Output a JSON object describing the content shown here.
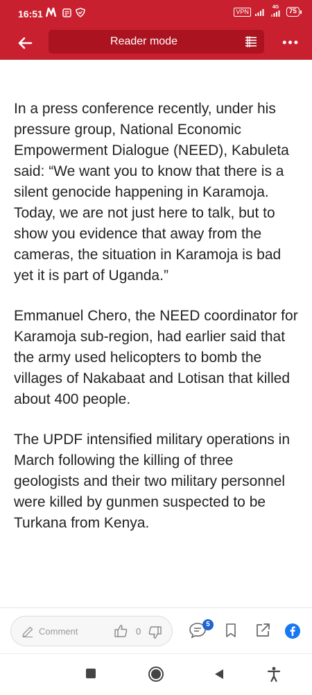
{
  "status_bar": {
    "time": "16:51",
    "vpn": "VPN",
    "network": "4G",
    "battery": "75"
  },
  "top_bar": {
    "title": "Reader mode"
  },
  "article": {
    "paragraphs": [
      "In a press conference recently, under his pressure group, National Economic Empowerment Dialogue (NEED), Kabuleta said: “We want you to know that there is a silent genocide happening in Karamoja. Today, we are not just here to talk, but to show you evidence that away from the cameras, the situation in Karamoja is bad yet it is part of Uganda.”",
      "Emmanuel Chero, the NEED coordinator for Karamoja sub-region, had earlier said that the army used helicopters to bomb the villages of Nakabaat and Lotisan that killed about 400 people.",
      "The UPDF intensified military operations in March following the killing of three geologists and their two military personnel were killed by gunmen suspected to be Turkana from Kenya."
    ]
  },
  "bottom_bar": {
    "comment_placeholder": "Comment",
    "like_count": "0",
    "comments_badge": "5"
  },
  "icons": {
    "back": "arrow-left-icon",
    "reader": "reader-list-icon",
    "more": "more-dots-icon",
    "pencil": "pencil-icon",
    "like": "thumbs-up-icon",
    "dislike": "thumbs-down-icon",
    "comments": "chat-bubble-icon",
    "bookmark": "bookmark-icon",
    "share": "share-icon",
    "facebook": "facebook-icon"
  },
  "colors": {
    "brand_red": "#c8202e",
    "reader_box": "#ab1320",
    "badge_blue": "#1d63d1",
    "facebook_blue": "#1877f2"
  }
}
